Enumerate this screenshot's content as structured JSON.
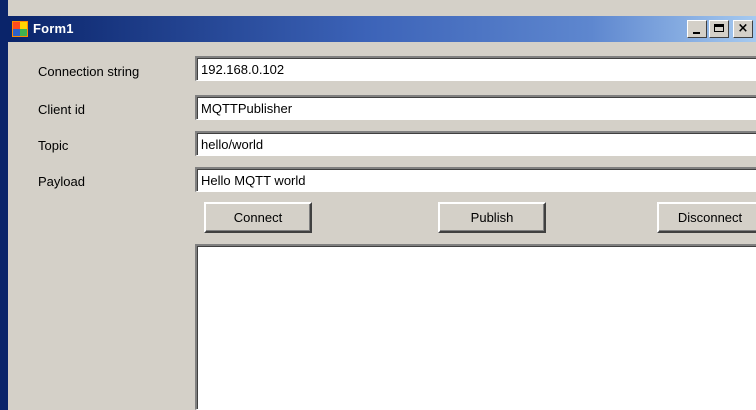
{
  "window": {
    "title": "Form1",
    "accent_color": "#0a246a",
    "face_color": "#d4d0c8",
    "title_buttons": {
      "minimize_icon": "minimize-icon",
      "maximize_icon": "maximize-icon",
      "close_icon": "close-icon",
      "close_glyph": "×"
    }
  },
  "form": {
    "fields": [
      {
        "label": "Connection string",
        "value": "192.168.0.102"
      },
      {
        "label": "Client id",
        "value": "MQTTPublisher"
      },
      {
        "label": "Topic",
        "value": "hello/world"
      },
      {
        "label": "Payload",
        "value": "Hello MQTT world"
      }
    ],
    "buttons": {
      "connect": "Connect",
      "publish": "Publish",
      "disconnect": "Disconnect"
    },
    "output_text": ""
  }
}
